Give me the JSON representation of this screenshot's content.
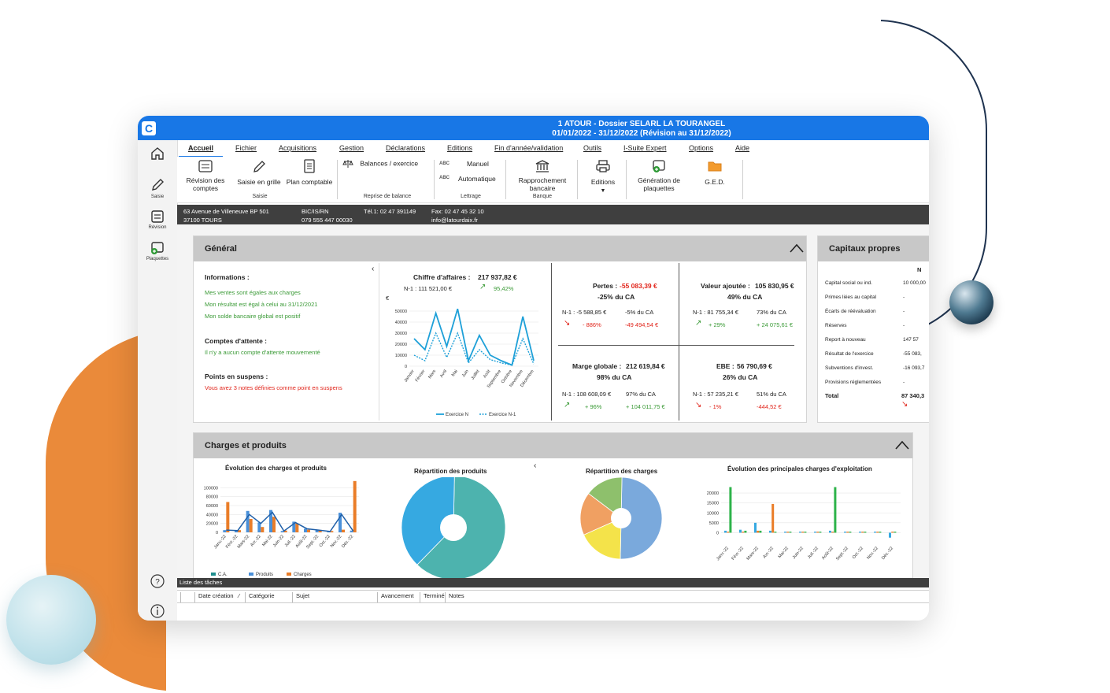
{
  "window": {
    "title_line1": "1 ATOUR - Dossier SELARL LA TOURANGEL",
    "title_line2": "01/01/2022 - 31/12/2022 (Révision au 31/12/2022)",
    "logo_letter": "C"
  },
  "leftbar": {
    "saisie": "Saisie",
    "revision": "Révision",
    "plaquettes": "Plaquettes"
  },
  "menu": [
    "Accueil",
    "Fichier",
    "Acquisitions",
    "Gestion",
    "Déclarations",
    "Editions",
    "Fin d'année/validation",
    "Outils",
    "I-Suite Expert",
    "Options",
    "Aide"
  ],
  "ribbon": {
    "revision": "Révision des comptes",
    "saisie_grille": "Saisie en grille",
    "plan_comptable": "Plan comptable",
    "group_saisie": "Saisie",
    "balances": "Balances / exercice",
    "group_reprise": "Reprise de balance",
    "manuel": "Manuel",
    "automatique": "Automatique",
    "group_lettrage": "Lettrage",
    "rapprochement": "Rapprochement bancaire",
    "group_banque": "Banque",
    "editions": "Editions",
    "generation": "Génération de plaquettes",
    "ged": "G.E.D.",
    "abc": "ABC"
  },
  "infobar": {
    "address1": "63 Avenue de Villeneuve BP 501",
    "address2": "37100 TOURS",
    "regime": "BIC/IS/RN",
    "siren": "079 555 447 00030",
    "tel": "Tél.1: 02 47 391149",
    "fax": "Fax: 02 47 45 32 10",
    "email": "info@latourdaix.fr"
  },
  "general": {
    "title": "Général",
    "informations_title": "Informations :",
    "info_lines": [
      "Mes ventes sont égales aux charges",
      "Mon résultat est égal à celui au 31/12/2021",
      "Mon solde bancaire global est positif"
    ],
    "attente_title": "Comptes d'attente :",
    "attente_line": "Il n'y a aucun compte d'attente mouvementé",
    "suspens_title": "Points en suspens :",
    "suspens_line": "Vous avez 3 notes définies comme point en suspens",
    "ca_label": "Chiffre d'affaires :",
    "ca_value": "217 937,82 €",
    "ca_n1": "N-1 : 111 521,00 €",
    "ca_pct": "95,42%",
    "euro_unit": "€",
    "pertes_label": "Pertes :",
    "pertes_value": "-55 083,39 €",
    "pertes_pct": "-25% du CA",
    "pertes_n1": "N-1 : -5 588,85 €",
    "pertes_n1_pct": "-5% du CA",
    "pertes_var": "- 886%",
    "pertes_diff": "-49 494,54 €",
    "va_label": "Valeur ajoutée :",
    "va_value": "105 830,95 €",
    "va_pct": "49% du CA",
    "va_n1": "N-1 : 81 755,34 €",
    "va_n1_pct": "73% du CA",
    "va_var": "+ 29%",
    "va_diff": "+ 24 075,61 €",
    "marge_label": "Marge globale :",
    "marge_value": "212 619,84 €",
    "marge_pct": "98% du CA",
    "marge_n1": "N-1 : 108 608,09 €",
    "marge_n1_pct": "97% du CA",
    "marge_var": "+ 96%",
    "marge_diff": "+ 104 011,75 €",
    "ebe_label": "EBE :",
    "ebe_value": "56 790,69 €",
    "ebe_pct": "26% du CA",
    "ebe_n1": "N-1 : 57 235,21 €",
    "ebe_n1_pct": "51% du CA",
    "ebe_var": "- 1%",
    "ebe_diff": "-444,52 €"
  },
  "capitaux": {
    "title": "Capitaux propres",
    "col": "N",
    "rows": [
      {
        "label": "Capital social ou ind.",
        "value": "10 000,00"
      },
      {
        "label": "Primes liées au capital",
        "value": "-"
      },
      {
        "label": "Écarts de réévaluation",
        "value": "-"
      },
      {
        "label": "Réserves",
        "value": "-"
      },
      {
        "label": "Report à nouveau",
        "value": "147 57"
      },
      {
        "label": "Résultat de l'exercice",
        "value": "-55 083,"
      },
      {
        "label": "Subventions d'invest.",
        "value": "-16 093,7"
      },
      {
        "label": "Provisions réglementées",
        "value": "-"
      }
    ],
    "total_label": "Total",
    "total_value": "87 340,3"
  },
  "charges": {
    "title": "Charges et produits",
    "evol_title": "Évolution des charges et produits",
    "produits_title": "Répartition des produits",
    "charges_title": "Répartition des charges",
    "principales_title": "Évolution des principales charges d'exploitation"
  },
  "tasks": {
    "title": "Liste des tâches",
    "columns": [
      "Date création",
      "Catégorie",
      "Sujet",
      "Avancement",
      "Terminé",
      "Notes"
    ]
  },
  "colors": {
    "accent": "#1877e6",
    "orange": "#ea8a3a",
    "line_blue": "#1ea0d8",
    "green": "#3a9a36",
    "red": "#e1251b"
  },
  "chart_data": [
    {
      "type": "line",
      "title": "Chiffre d'affaires",
      "x": [
        "Janvier",
        "Février",
        "Mars",
        "Avril",
        "Mai",
        "Juin",
        "Juillet",
        "Août",
        "Septembre",
        "Octobre",
        "Novembre",
        "Décembre"
      ],
      "series": [
        {
          "name": "Exercice N",
          "values": [
            25000,
            15000,
            48000,
            18000,
            52000,
            5000,
            28000,
            10000,
            5000,
            1000,
            45000,
            5000
          ]
        },
        {
          "name": "Exercice N-1",
          "values": [
            10000,
            5000,
            30000,
            8000,
            30000,
            3000,
            15000,
            6000,
            3000,
            1000,
            25000,
            2000
          ]
        }
      ],
      "yticks": [
        "0",
        "10000",
        "20000",
        "30000",
        "40000",
        "50000"
      ],
      "ylim": [
        0,
        55000
      ]
    },
    {
      "type": "bar",
      "title": "Évolution des charges et produits",
      "categories": [
        "Janv.-22",
        "Févr.-22",
        "Mars-22",
        "Avr.-22",
        "Mai-22",
        "Juin-22",
        "Juil.-22",
        "Août-22",
        "Sept.-22",
        "Oct.-22",
        "Nov.-22",
        "Déc.-22"
      ],
      "series": [
        {
          "name": "C.A.",
          "values": [
            5000,
            4000,
            40000,
            20000,
            45000,
            3000,
            22000,
            8000,
            5000,
            2000,
            40000,
            3000
          ]
        },
        {
          "name": "Produits",
          "values": [
            5000,
            4000,
            48000,
            22000,
            50000,
            3000,
            24000,
            8000,
            5000,
            2000,
            44000,
            4000
          ]
        },
        {
          "name": "Charges",
          "values": [
            68000,
            5000,
            30000,
            12000,
            35000,
            4000,
            20000,
            6000,
            4000,
            3000,
            6000,
            115000
          ]
        }
      ],
      "yticks": [
        "0",
        "20000",
        "40000",
        "60000",
        "80000",
        "100000"
      ],
      "ylim": [
        0,
        120000
      ]
    },
    {
      "type": "pie",
      "title": "Répartition des produits",
      "values": [
        0.62,
        0.38
      ]
    },
    {
      "type": "pie",
      "title": "Répartition des charges",
      "values": [
        0.5,
        0.18,
        0.17,
        0.15
      ]
    },
    {
      "type": "bar",
      "title": "Évolution des principales charges d'exploitation",
      "categories": [
        "Janv.-22",
        "Févr.-22",
        "Mars-22",
        "Avr.-22",
        "Mai-22",
        "Juin-22",
        "Juil.-22",
        "Août-22",
        "Sept.-22",
        "Oct.-22",
        "Nov.-22",
        "Déc.-22"
      ],
      "series": [
        {
          "values": [
            1000,
            1500,
            5000,
            1000,
            500,
            500,
            500,
            1000,
            500,
            500,
            500,
            -2500
          ]
        },
        {
          "values": [
            500,
            500,
            1000,
            14500,
            500,
            500,
            500,
            500,
            500,
            500,
            500,
            500
          ]
        },
        {
          "values": [
            23000,
            1000,
            1000,
            500,
            500,
            500,
            500,
            23000,
            500,
            500,
            500,
            500
          ]
        }
      ],
      "yticks": [
        "0",
        "5000",
        "10000",
        "15000",
        "20000"
      ],
      "ylim": [
        -3000,
        24000
      ]
    }
  ]
}
